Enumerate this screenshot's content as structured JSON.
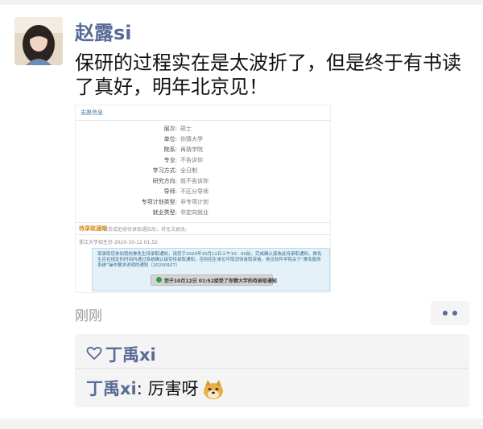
{
  "post": {
    "username": "赵露si",
    "text": "保研的过程实在是太波折了，但是终于有书读了真好，明年北京见！",
    "time": "刚刚"
  },
  "screenshot": {
    "header": "志愿信息",
    "rows": [
      {
        "k": "层次:",
        "v": "硕士"
      },
      {
        "k": "单位:",
        "v": "你猜大学"
      },
      {
        "k": "院系:",
        "v": "再猜学院"
      },
      {
        "k": "专业:",
        "v": "不告诉你"
      },
      {
        "k": "学习方式:",
        "v": "全日制"
      },
      {
        "k": "研究方向:",
        "v": "就不告诉你"
      },
      {
        "k": "导师:",
        "v": "不区分导师"
      },
      {
        "k": "专项计划类型:",
        "v": "非专项计划"
      },
      {
        "k": "就业类型:",
        "v": "非定向就业"
      }
    ],
    "section2_title": "待录取通知",
    "section2_note": "接受或拒绝待录取通知后，将无法更改。",
    "from_line": "浙江大学招生办 2020-10-12 01:52",
    "notice_text": "现录取您参加我校推免生待录取通知，请您于2020年10月12日上午10：00前，完成确认接收此待录取通知。推免生应在规定的时间内通过系统确认接受待录取通知，否则招生单位可取消待录取资格。参见软件学院关于“推免服务系统”操作要求说明的通知（20200927）",
    "button_text": "您于10月12日 01:52接受了你猜大学的待录取通知"
  },
  "likes": {
    "name": "丁禹xi"
  },
  "comment": {
    "name": "丁禹xi",
    "text": ": 厉害呀"
  },
  "icons": {
    "like": "heart-icon",
    "more": "more-dots-icon",
    "emoji": "doge-emoji-icon"
  },
  "colors": {
    "name_color": "#576b95",
    "panel_bg": "#f4f4f4"
  }
}
